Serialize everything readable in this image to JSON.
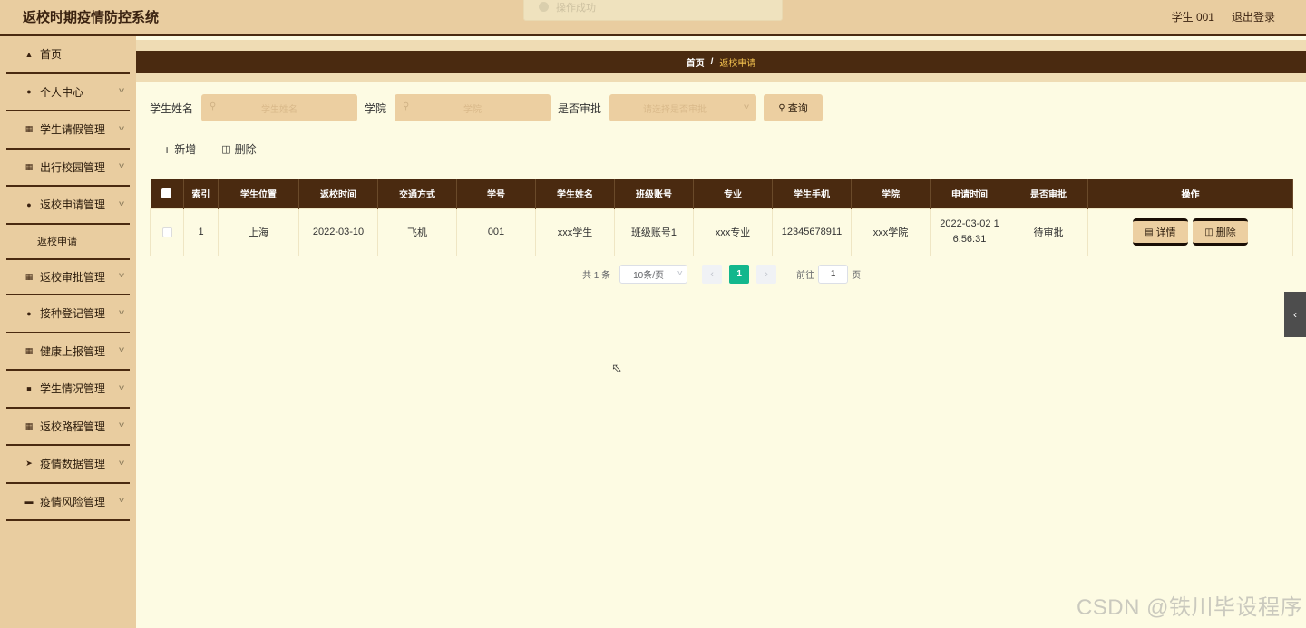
{
  "header": {
    "title": "返校时期疫情防控系统",
    "user": "学生 001",
    "logout": "退出登录"
  },
  "toast": {
    "text": "操作成功"
  },
  "sidebar": {
    "items": [
      {
        "label": "首页",
        "icon": "home-icon"
      },
      {
        "label": "个人中心",
        "icon": "user-icon"
      },
      {
        "label": "学生请假管理",
        "icon": "grid-icon"
      },
      {
        "label": "出行校园管理",
        "icon": "grid-icon"
      },
      {
        "label": "返校申请管理",
        "icon": "user-icon"
      },
      {
        "label": "返校审批管理",
        "icon": "grid-icon"
      },
      {
        "label": "接种登记管理",
        "icon": "user-icon"
      },
      {
        "label": "健康上报管理",
        "icon": "grid-icon"
      },
      {
        "label": "学生情况管理",
        "icon": "wallet-icon"
      },
      {
        "label": "返校路程管理",
        "icon": "grid-icon"
      },
      {
        "label": "疫情数据管理",
        "icon": "send-icon"
      },
      {
        "label": "疫情风险管理",
        "icon": "monitor-icon"
      }
    ],
    "sub_item": "返校申请"
  },
  "breadcrumb": {
    "home": "首页",
    "sep": "/",
    "current": "返校申请"
  },
  "search": {
    "name_label": "学生姓名",
    "name_placeholder": "学生姓名",
    "college_label": "学院",
    "college_placeholder": "学院",
    "approve_label": "是否审批",
    "approve_placeholder": "请选择是否审批",
    "query_label": "查询"
  },
  "actions": {
    "add": "新增",
    "delete": "删除"
  },
  "table": {
    "headers": [
      "索引",
      "学生位置",
      "返校时间",
      "交通方式",
      "学号",
      "学生姓名",
      "班级账号",
      "专业",
      "学生手机",
      "学院",
      "申请时间",
      "是否审批",
      "操作"
    ],
    "rows": [
      {
        "index": "1",
        "location": "上海",
        "return_time": "2022-03-10",
        "transport": "飞机",
        "student_no": "001",
        "student_name": "xxx学生",
        "class_account": "班级账号1",
        "major": "xxx专业",
        "phone": "12345678911",
        "college": "xxx学院",
        "apply_time_1": "2022-03-02 1",
        "apply_time_2": "6:56:31",
        "approved": "待审批",
        "detail_btn": "详情",
        "delete_btn": "删除"
      }
    ]
  },
  "pagination": {
    "total": "共 1 条",
    "page_size": "10条/页",
    "current_page": "1",
    "goto_label": "前往",
    "goto_value": "1",
    "page_suffix": "页"
  },
  "watermark": "CSDN @铁川毕设程序",
  "colors": {
    "accent": "#4a2a10",
    "panel": "#e9cda0",
    "page": "#fdfbe3",
    "active_page": "#13b78d"
  }
}
